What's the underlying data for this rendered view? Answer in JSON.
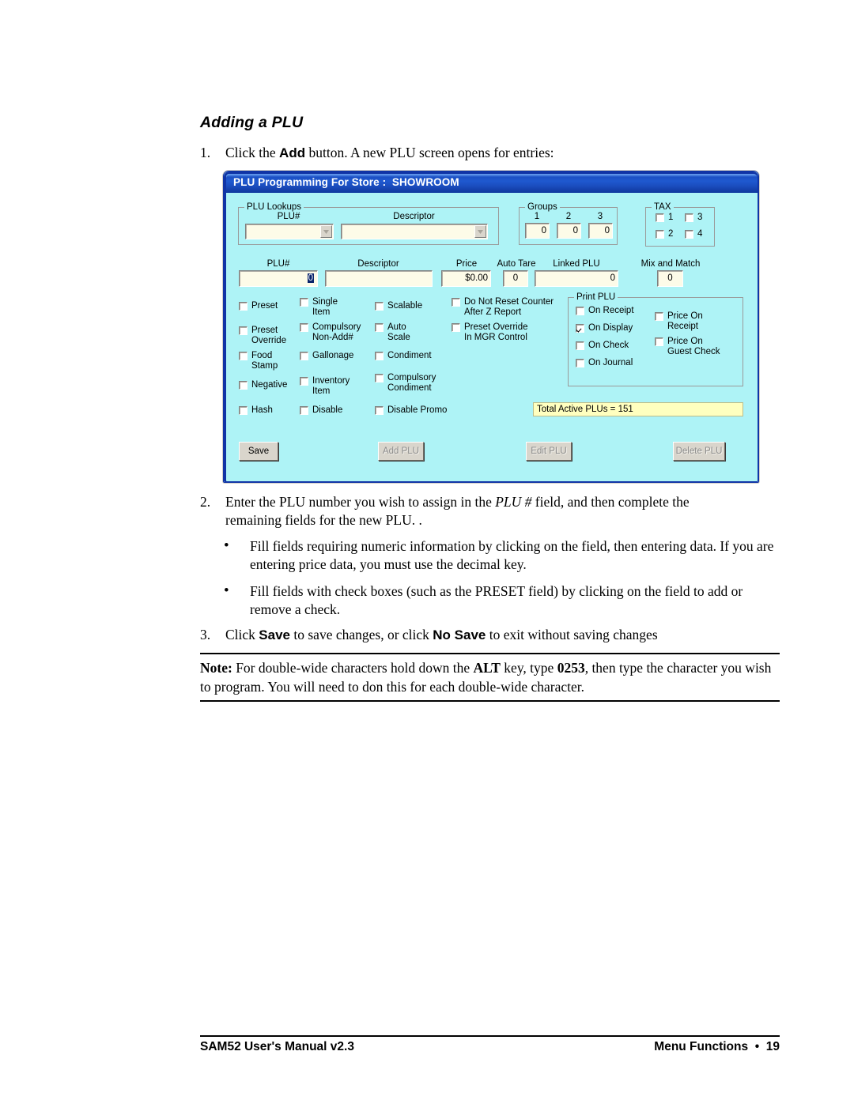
{
  "document": {
    "section_title": "Adding a PLU",
    "steps": [
      {
        "num": "1.",
        "text_before": "Click the ",
        "bold": "Add",
        "text_after": " button.  A new PLU screen opens for entries:"
      },
      {
        "num": "2.",
        "line1_a": "Enter the PLU number you wish to assign in the ",
        "line1_italic": "PLU #",
        "line1_b": " field, and then complete the",
        "line2": "remaining fields for the new PLU.  ."
      },
      {
        "num": "3.",
        "a": "Click ",
        "b1": "Save",
        "c": " to save changes, or click ",
        "b2": "No Save",
        "d": " to exit without saving changes"
      }
    ],
    "bullets": [
      "Fill fields requiring numeric information by clicking on the field, then entering data. If you are entering price data, you must use the decimal key.",
      "Fill fields with check boxes (such as the PRESET field) by clicking on the field to add or remove a check."
    ],
    "bullet_glyph": "•",
    "note": {
      "label": "Note:",
      "a": "  For double-wide characters hold down the ",
      "alt": "ALT",
      "b": " key, type ",
      "code": "0253",
      "c": ", then type the character you wish to program.  You will need to don this for each double-wide character."
    },
    "footer": {
      "left": "SAM52 User's Manual v2.3",
      "right": "Menu Functions  •  19"
    }
  },
  "dialog": {
    "title": "PLU Programming For Store :  SHOWROOM",
    "colors": {
      "client_background": "#aef3f6",
      "titlebar": "#1b4fc4",
      "frame_border": "#1034a6",
      "input_background": "#fdfbe8",
      "status_background": "#ffffbf",
      "button_face": "#d9d5cc",
      "selection": "#0a246a"
    },
    "plu_lookups": {
      "legend": "PLU Lookups",
      "plu_number_label": "PLU#",
      "plu_number_value": "",
      "descriptor_label": "Descriptor",
      "descriptor_value": ""
    },
    "groups": {
      "legend": "Groups",
      "headers": [
        "1",
        "2",
        "3"
      ],
      "values": [
        "0",
        "0",
        "0"
      ]
    },
    "tax": {
      "legend": "TAX",
      "items": [
        {
          "label": "1",
          "checked": false
        },
        {
          "label": "3",
          "checked": false
        },
        {
          "label": "2",
          "checked": false
        },
        {
          "label": "4",
          "checked": false
        }
      ]
    },
    "main_fields": [
      {
        "label": "PLU#",
        "value": "0",
        "selected": true
      },
      {
        "label": "Descriptor",
        "value": ""
      },
      {
        "label": "Price",
        "value": "$0.00"
      },
      {
        "label": "Auto Tare",
        "value": "0"
      },
      {
        "label": "Linked PLU",
        "value": "0"
      },
      {
        "label": "Mix and Match",
        "value": "0"
      }
    ],
    "option_column_1": [
      {
        "label": "Preset",
        "checked": false
      },
      {
        "label": "Preset\nOverride",
        "checked": false
      },
      {
        "label": "Food\nStamp",
        "checked": false
      },
      {
        "label": "Negative",
        "checked": false
      },
      {
        "label": "Hash",
        "checked": false
      }
    ],
    "option_column_2": [
      {
        "label": "Single\nItem",
        "checked": false
      },
      {
        "label": "Compulsory\nNon-Add#",
        "checked": false
      },
      {
        "label": "Gallonage",
        "checked": false
      },
      {
        "label": "Inventory\nItem",
        "checked": false
      },
      {
        "label": "Disable",
        "checked": false
      }
    ],
    "option_column_3": [
      {
        "label": "Scalable",
        "checked": false
      },
      {
        "label": "Auto\nScale",
        "checked": false
      },
      {
        "label": "Condiment",
        "checked": false
      },
      {
        "label": "Compulsory\nCondiment",
        "checked": false
      },
      {
        "label": "Disable Promo",
        "checked": false
      }
    ],
    "option_column_4": [
      {
        "label": "Do Not Reset Counter\nAfter Z Report",
        "checked": false
      },
      {
        "label": "Preset Override\nIn MGR Control",
        "checked": false
      }
    ],
    "print_plu": {
      "legend": "Print PLU",
      "left_items": [
        {
          "label": "On Receipt",
          "checked": false
        },
        {
          "label": "On Display",
          "checked": true
        },
        {
          "label": "On Check",
          "checked": false
        },
        {
          "label": "On Journal",
          "checked": false
        }
      ],
      "right_items": [
        {
          "label": "Price On\nReceipt",
          "checked": false
        },
        {
          "label": "Price On\nGuest Check",
          "checked": false
        }
      ]
    },
    "status": {
      "text": "Total Active PLUs = 151"
    },
    "buttons": [
      {
        "label": "Save",
        "enabled": true
      },
      {
        "label": "Add PLU",
        "enabled": false
      },
      {
        "label": "Edit PLU",
        "enabled": false
      },
      {
        "label": "Delete PLU",
        "enabled": false
      }
    ]
  }
}
